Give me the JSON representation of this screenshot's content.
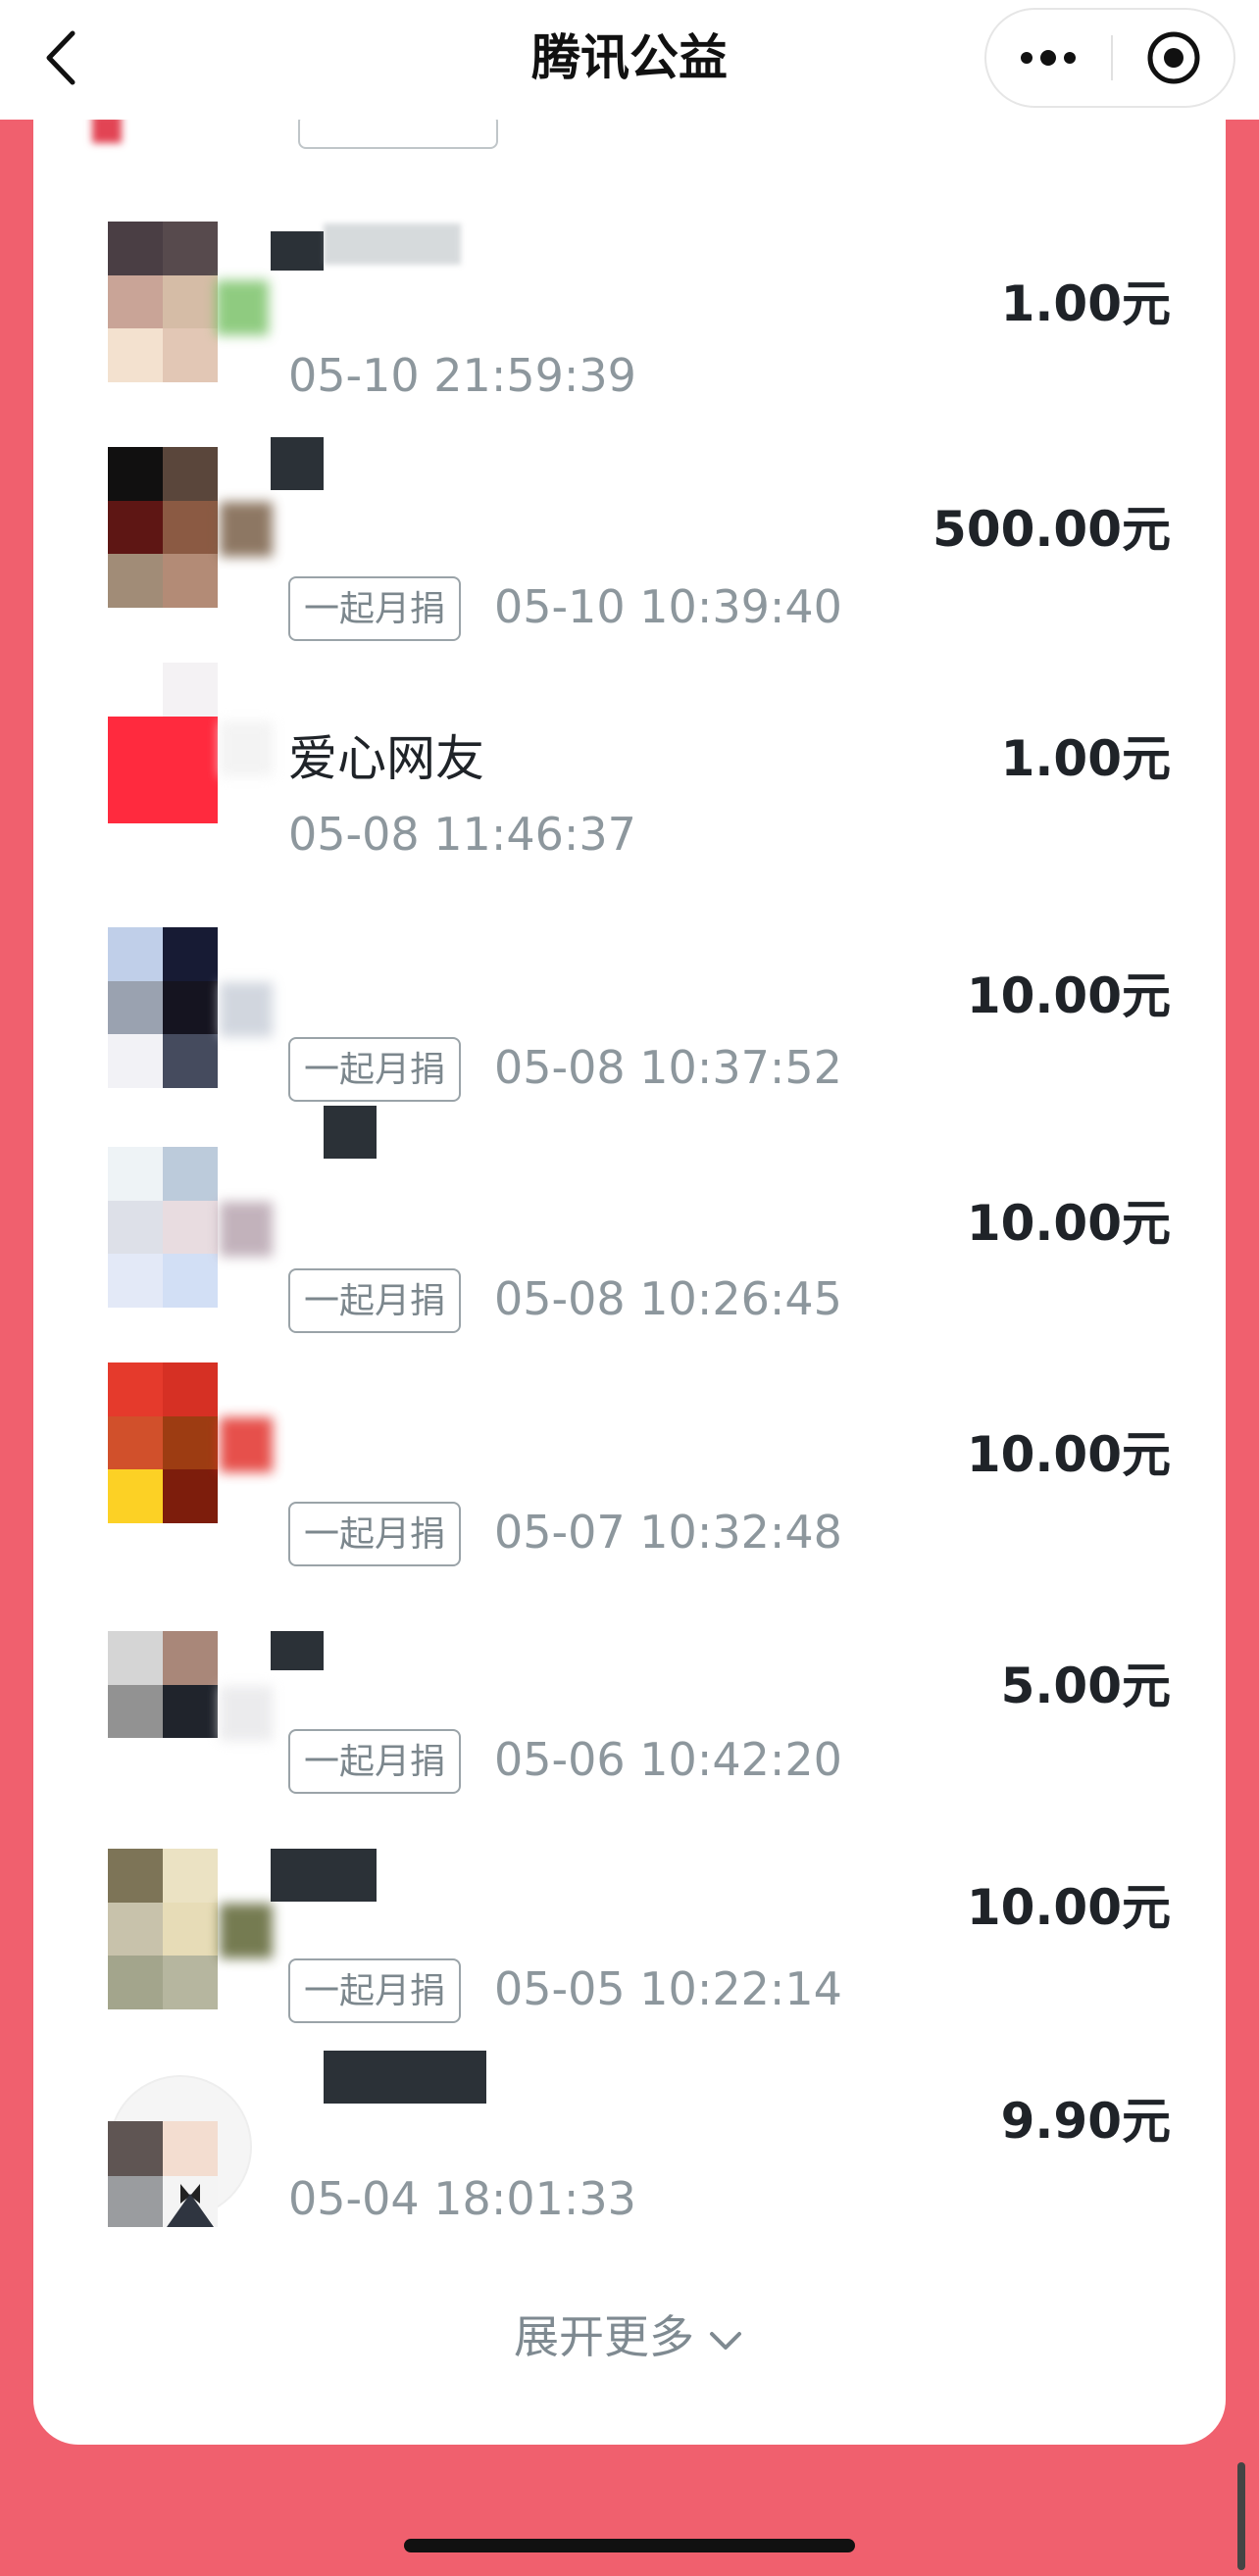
{
  "navbar": {
    "title": "腾讯公益",
    "back_icon": "chevron-left-icon",
    "more_icon": "more-dots-icon",
    "close_icon": "target-circle-icon"
  },
  "donations": [
    {
      "name": "",
      "amount": "1.00元",
      "tag": "",
      "time": "05-10 21:59:39"
    },
    {
      "name": "",
      "amount": "500.00元",
      "tag": "一起月捐",
      "time": "05-10 10:39:40"
    },
    {
      "name": "爱心网友",
      "amount": "1.00元",
      "tag": "",
      "time": "05-08 11:46:37"
    },
    {
      "name": "",
      "amount": "10.00元",
      "tag": "一起月捐",
      "time": "05-08 10:37:52"
    },
    {
      "name": "",
      "amount": "10.00元",
      "tag": "一起月捐",
      "time": "05-08 10:26:45"
    },
    {
      "name": "",
      "amount": "10.00元",
      "tag": "一起月捐",
      "time": "05-07 10:32:48"
    },
    {
      "name": "",
      "amount": "5.00元",
      "tag": "一起月捐",
      "time": "05-06 10:42:20"
    },
    {
      "name": "",
      "amount": "10.00元",
      "tag": "一起月捐",
      "time": "05-05 10:22:14"
    },
    {
      "name": "",
      "amount": "9.90元",
      "tag": "",
      "time": "05-04 18:01:33"
    }
  ],
  "expand_more": "展开更多",
  "colors": {
    "page_background": "#f0606e",
    "card_background": "#ffffff",
    "amount_text": "#1f2328",
    "time_text": "#8d979d"
  }
}
